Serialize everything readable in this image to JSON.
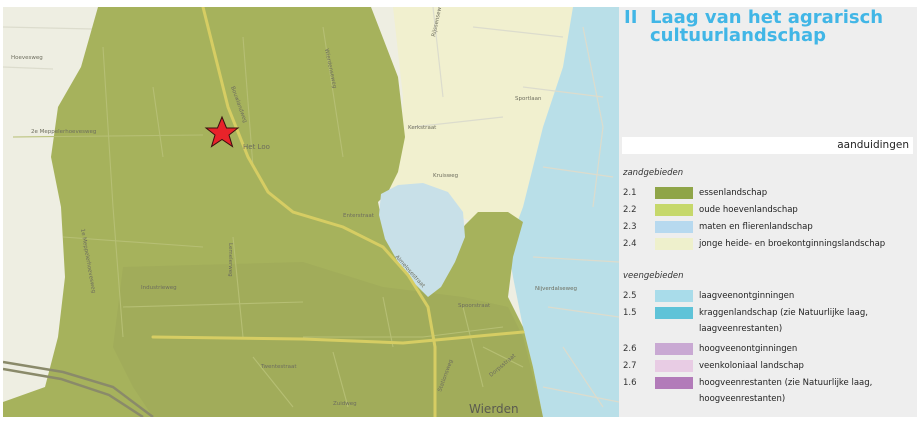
{
  "map": {
    "marker": "star-marker",
    "labels": {
      "road_1": "Hoevesweg",
      "road_2": "2e Meppelerhoevesweg",
      "road_3": "1e Meppelerhoevesweg",
      "road_4": "Bouwlandweg",
      "road_5": "Lemelerweg",
      "road_6": "Wierdenseweg",
      "road_7": "Enterstraat",
      "road_8": "Almelosestraat",
      "road_9": "Kruisweg",
      "road_10": "Spoorstraat",
      "road_11": "Rijssenseweg",
      "road_12": "Nijverdalseweg",
      "road_13": "Dorpsstraat",
      "road_14": "Industrieweg",
      "road_15": "Twentestraat",
      "road_16": "Sportlaan",
      "road_17": "Kerkstraat",
      "road_18": "Stationsweg",
      "road_19": "Zuidweg",
      "place_1": "Het Loo",
      "place_2": "Wierden"
    }
  },
  "panel": {
    "title_number": "II",
    "title_text": "Laag van het agrarisch cultuurlandschap",
    "legend_header": "aanduidingen",
    "groups": [
      {
        "title": "zandgebieden",
        "items": [
          {
            "code": "2.1",
            "label": "essenlandschap",
            "color": "#8fa548"
          },
          {
            "code": "2.2",
            "label": "oude hoevenlandschap",
            "color": "#c6d86b"
          },
          {
            "code": "2.3",
            "label": "maten en flierenlandschap",
            "color": "#b7d9ef"
          },
          {
            "code": "2.4",
            "label": "jonge heide- en broekontginningslandschap",
            "color": "#eef0cc"
          }
        ]
      },
      {
        "title": "veengebieden",
        "items": [
          {
            "code": "2.5",
            "label": "laagveenontginningen",
            "color": "#a9dcea"
          },
          {
            "code": "1.5",
            "label": "kraggenlandschap  (zie Natuurlijke laag, laagveenrestanten)",
            "color": "#5fc3d8"
          },
          {
            "code": "2.6",
            "label": "hoogveenontginningen",
            "color": "#c9a9d3"
          },
          {
            "code": "2.7",
            "label": "veenkoloniaal landschap",
            "color": "#e8cce4"
          },
          {
            "code": "1.6",
            "label": "hoogveenrestanten (zie Natuurlijke laag, hoogveenrestanten)",
            "color": "#b27bb9"
          }
        ]
      }
    ]
  }
}
